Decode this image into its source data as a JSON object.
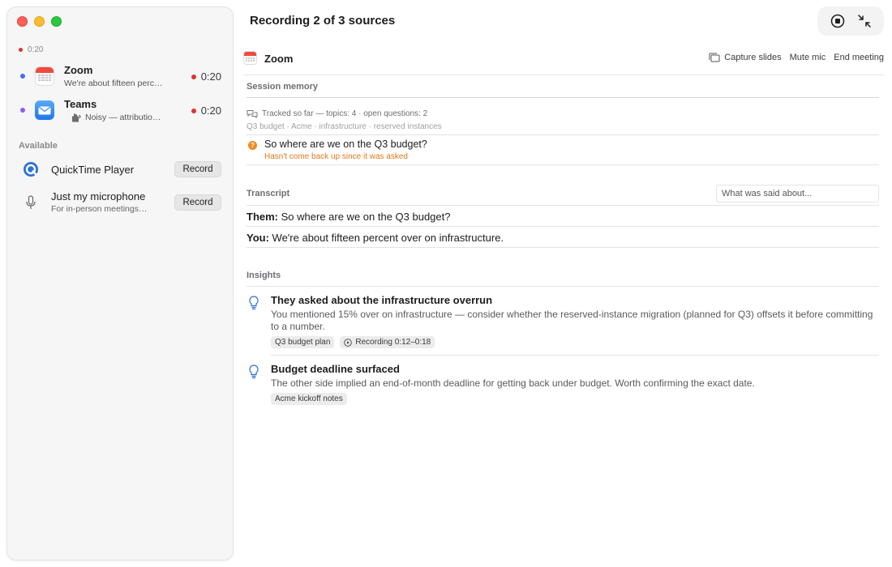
{
  "sidebar": {
    "timer": "0:20",
    "sources": [
      {
        "name": "Zoom",
        "subtitle": "We're about fifteen perc…",
        "time": "0:20",
        "dot_color": "#4a6cf7",
        "icon": "calendar-icon"
      },
      {
        "name": "Teams",
        "subtitle": "Noisy — attributio…",
        "time": "0:20",
        "dot_color": "#8b5cf6",
        "icon": "mail-icon"
      }
    ],
    "available_label": "Available",
    "available": [
      {
        "name": "QuickTime Player",
        "subtitle": "",
        "button": "Record",
        "icon": "quicktime-icon"
      },
      {
        "name": "Just my microphone",
        "subtitle": "For in-person meetings…",
        "button": "Record",
        "icon": "microphone-icon"
      }
    ]
  },
  "header": {
    "title": "Recording 2 of 3 sources",
    "controls": [
      "stop-icon",
      "collapse-icon"
    ]
  },
  "app_header": {
    "name": "Zoom",
    "actions": {
      "capture": "Capture slides",
      "mute": "Mute mic",
      "end": "End meeting"
    }
  },
  "session_memory": {
    "label": "Session memory",
    "tracked": "Tracked so far — topics: 4 · open questions: 2",
    "topics": "Q3 budget · Acme · infrastructure · reserved instances",
    "question": {
      "text": "So where are we on the Q3 budget?",
      "status": "Hasn't come back up since it was asked",
      "badge": "?"
    }
  },
  "transcript": {
    "label": "Transcript",
    "search_placeholder": "What was said about...",
    "lines": [
      {
        "speaker": "Them:",
        "text": "So where are we on the Q3 budget?"
      },
      {
        "speaker": "You:",
        "text": "We're about fifteen percent over on infrastructure."
      }
    ]
  },
  "insights": {
    "label": "Insights",
    "items": [
      {
        "title": "They asked about the infrastructure overrun",
        "body": "You mentioned 15% over on infrastructure — consider whether the reserved-instance migration (planned for Q3) offsets it before committing to a number.",
        "chips": [
          "Q3 budget plan",
          "Recording 0:12–0:18"
        ]
      },
      {
        "title": "Budget deadline surfaced",
        "body": "The other side implied an end-of-month deadline for getting back under budget. Worth confirming the exact date.",
        "chips": [
          "Acme kickoff notes"
        ]
      }
    ]
  },
  "colors": {
    "recording_red": "#e0342d",
    "accent_blue": "#2f6bd8",
    "question_orange": "#f08a24"
  }
}
